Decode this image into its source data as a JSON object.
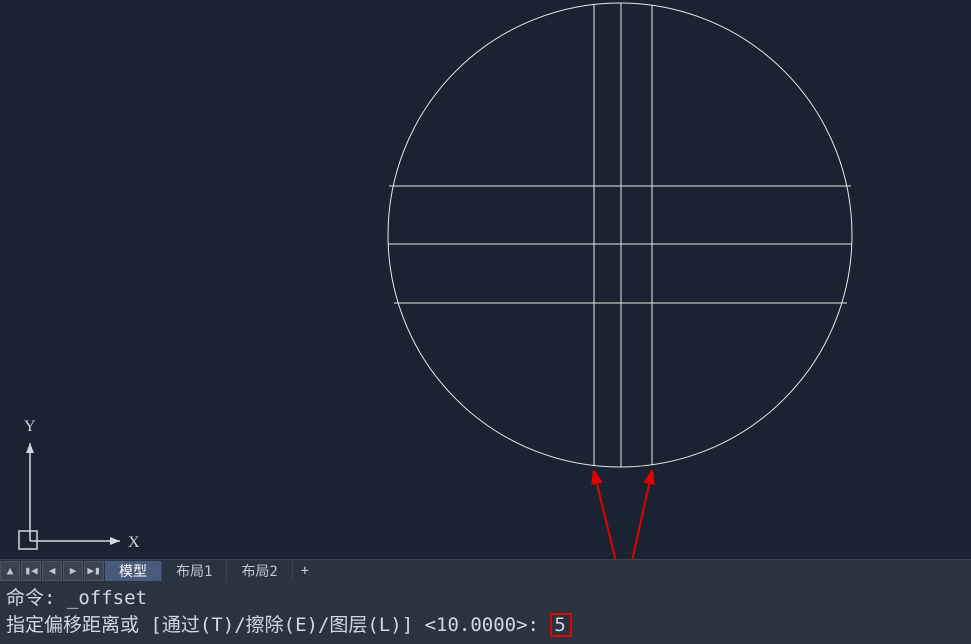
{
  "ucs": {
    "x_label": "X",
    "y_label": "Y"
  },
  "tabs": {
    "model": "模型",
    "layout1": "布局1",
    "layout2": "布局2",
    "add": "+"
  },
  "nav": {
    "collapse": "▲",
    "first": "▮◀",
    "prev": "◀",
    "next": "▶",
    "last": "▶▮"
  },
  "command": {
    "history_prefix": "命令: ",
    "history_cmd": "_offset",
    "prompt": "指定偏移距离或 [通过(T)/擦除(E)/图层(L)] <10.0000>: ",
    "input_value": "5"
  }
}
